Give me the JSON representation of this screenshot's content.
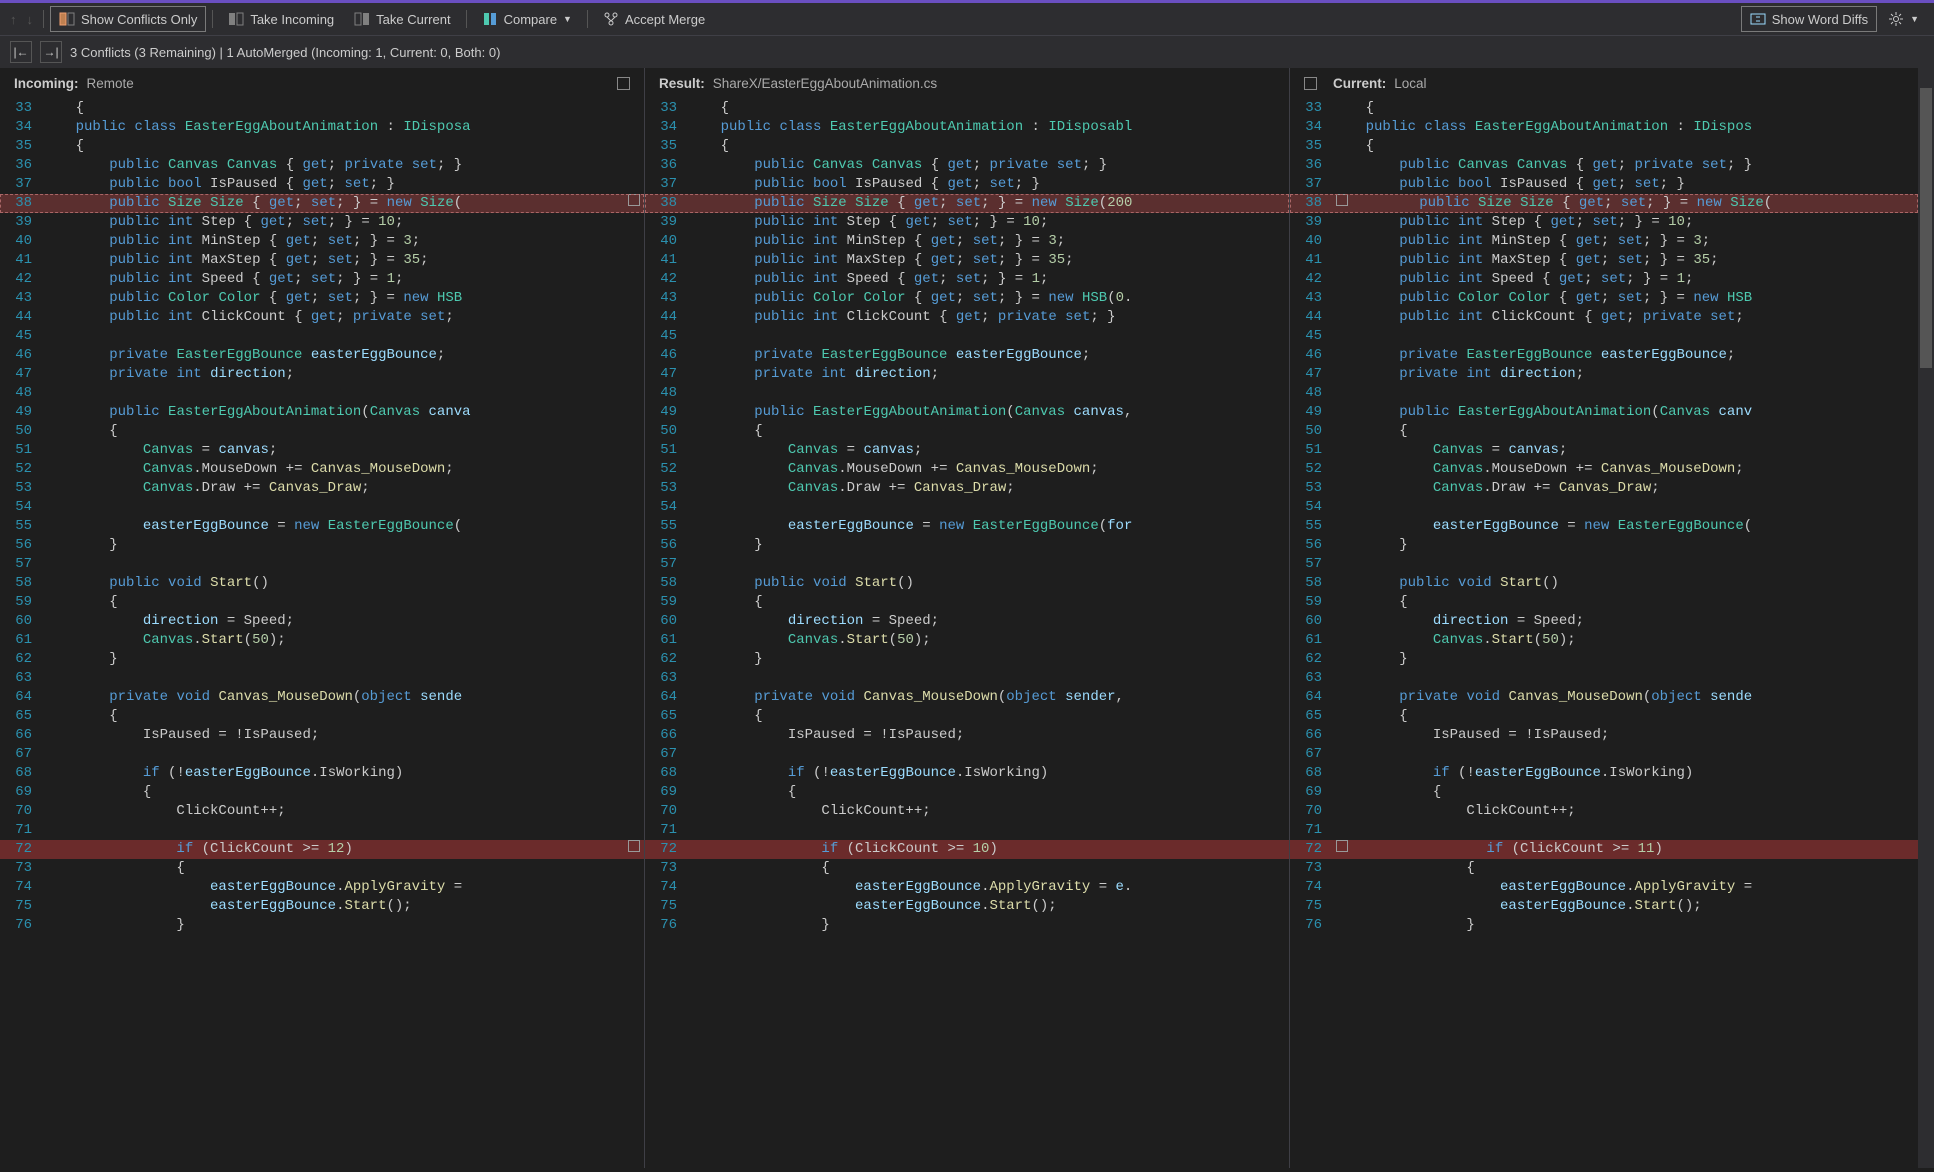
{
  "toolbar": {
    "show_conflicts": "Show Conflicts Only",
    "take_incoming": "Take Incoming",
    "take_current": "Take Current",
    "compare": "Compare",
    "accept_merge": "Accept Merge",
    "show_word_diffs": "Show Word Diffs"
  },
  "status": "3 Conflicts (3 Remaining) | 1 AutoMerged (Incoming: 1, Current: 0, Both: 0)",
  "panes": {
    "incoming": {
      "label": "Incoming:",
      "sub": "Remote"
    },
    "result": {
      "label": "Result:",
      "sub": "ShareX/EasterEggAboutAnimation.cs"
    },
    "current": {
      "label": "Current:",
      "sub": "Local"
    }
  },
  "lines": {
    "33": "    {",
    "34_l": "    public class EasterEggAboutAnimation : IDisposa",
    "34_m": "    public class EasterEggAboutAnimation : IDisposabl",
    "34_r": "    public class EasterEggAboutAnimation : IDispos",
    "35": "    {",
    "36_l": "        public Canvas Canvas { get; private set; }",
    "36_m": "        public Canvas Canvas { get; private set; }",
    "36_r": "        public Canvas Canvas { get; private set; }",
    "37": "        public bool IsPaused { get; set; }",
    "38_l": "        public Size Size { get; set; } = new Size(",
    "38_m": "        public Size Size { get; set; } = new Size(200",
    "38_r": "        public Size Size { get; set; } = new Size(",
    "39": "        public int Step { get; set; } = 10;",
    "40": "        public int MinStep { get; set; } = 3;",
    "41": "        public int MaxStep { get; set; } = 35;",
    "42": "        public int Speed { get; set; } = 1;",
    "43_l": "        public Color Color { get; set; } = new HSB",
    "43_m": "        public Color Color { get; set; } = new HSB(0.",
    "43_r": "        public Color Color { get; set; } = new HSB",
    "44_l": "        public int ClickCount { get; private set; ",
    "44_m": "        public int ClickCount { get; private set; }",
    "44_r": "        public int ClickCount { get; private set; ",
    "45": "",
    "46": "        private EasterEggBounce easterEggBounce;",
    "47": "        private int direction;",
    "48": "",
    "49_l": "        public EasterEggAboutAnimation(Canvas canva",
    "49_m": "        public EasterEggAboutAnimation(Canvas canvas,",
    "49_r": "        public EasterEggAboutAnimation(Canvas canv",
    "50": "        {",
    "51": "            Canvas = canvas;",
    "52": "            Canvas.MouseDown += Canvas_MouseDown;",
    "53": "            Canvas.Draw += Canvas_Draw;",
    "54": "",
    "55_l": "            easterEggBounce = new EasterEggBounce(",
    "55_m": "            easterEggBounce = new EasterEggBounce(for",
    "55_r": "            easterEggBounce = new EasterEggBounce(",
    "56": "        }",
    "57": "",
    "58": "        public void Start()",
    "59": "        {",
    "60": "            direction = Speed;",
    "61": "            Canvas.Start(50);",
    "62": "        }",
    "63": "",
    "64_l": "        private void Canvas_MouseDown(object sende",
    "64_m": "        private void Canvas_MouseDown(object sender,",
    "64_r": "        private void Canvas_MouseDown(object sende",
    "65": "        {",
    "66": "            IsPaused = !IsPaused;",
    "67": "",
    "68": "            if (!easterEggBounce.IsWorking)",
    "69": "            {",
    "70": "                ClickCount++;",
    "71": "",
    "72_l": "                if (ClickCount >= 12)",
    "72_m": "                if (ClickCount >= 10)",
    "72_r": "                if (ClickCount >= 11)",
    "73": "                {",
    "74_l": "                    easterEggBounce.ApplyGravity =",
    "74_m": "                    easterEggBounce.ApplyGravity = e.",
    "74_r": "                    easterEggBounce.ApplyGravity =",
    "75": "                    easterEggBounce.Start();",
    "76": "                }"
  }
}
